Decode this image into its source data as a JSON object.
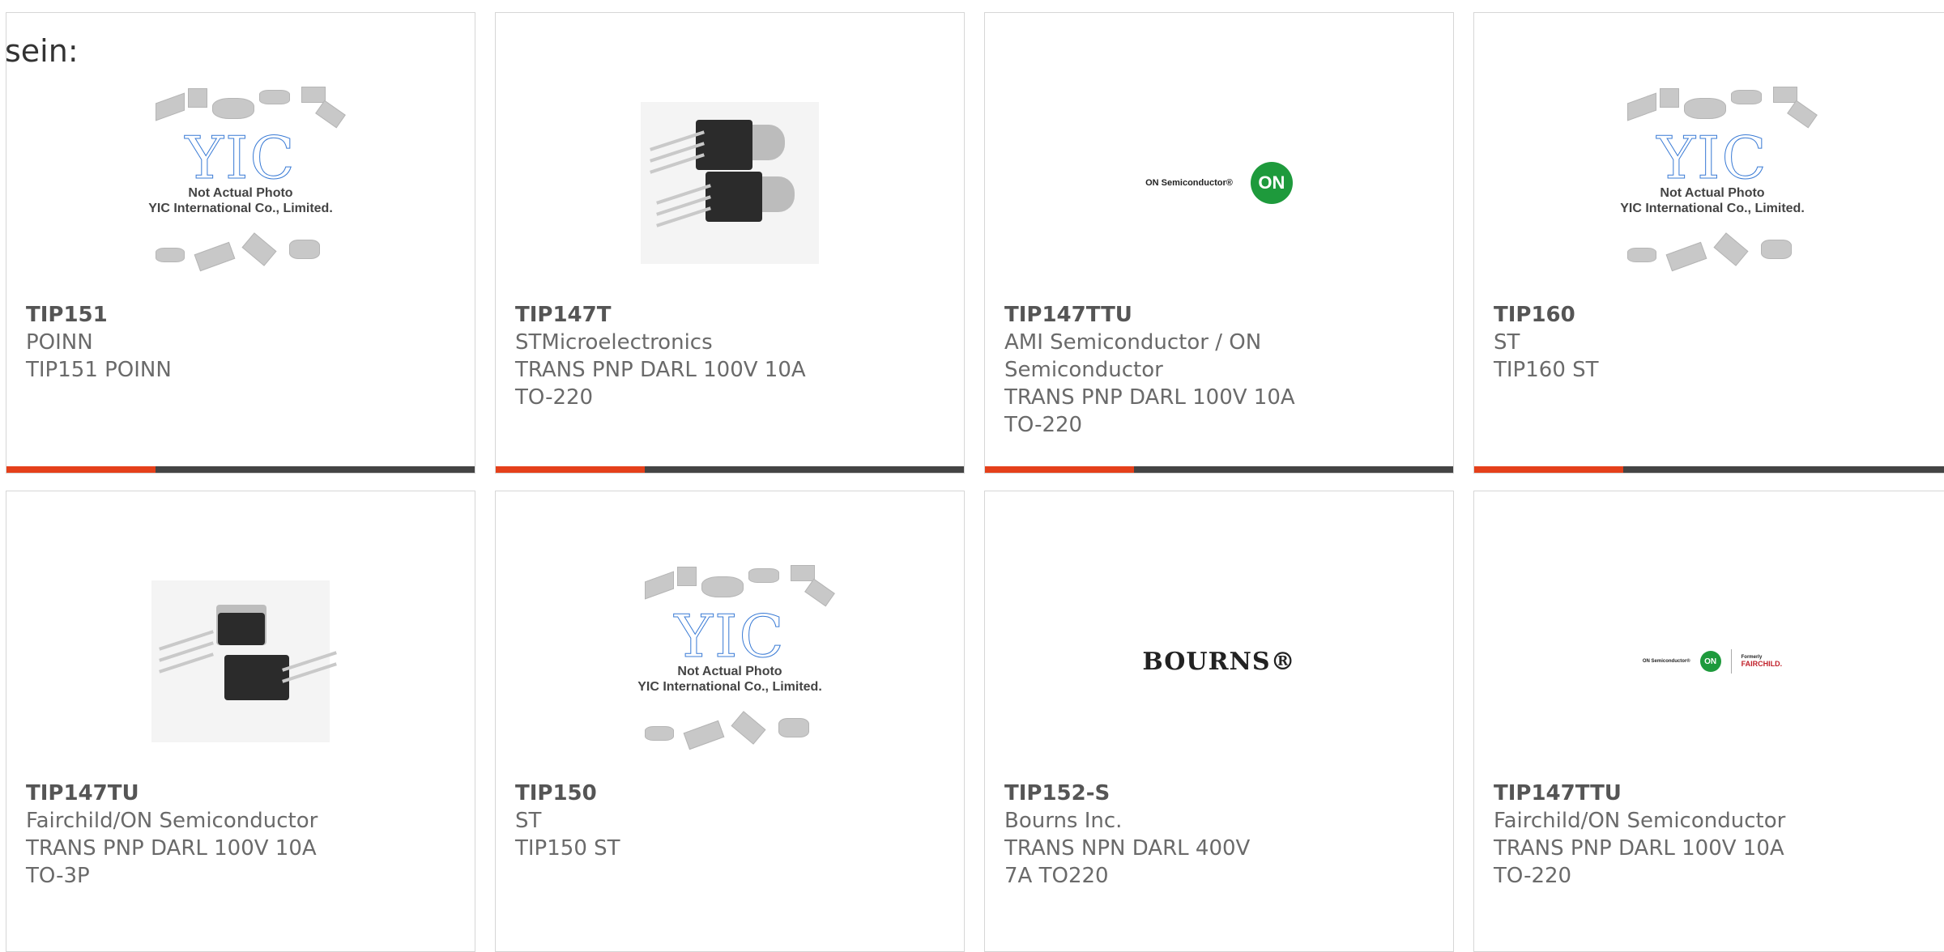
{
  "lead_text": "sein:",
  "products": [
    {
      "part": "TIP151",
      "manufacturer": "POINN",
      "description": "TIP151 POINN",
      "image": "placeholder",
      "placeholder_caption_1": "Not Actual Photo",
      "placeholder_caption_2": "YIC International Co., Limited."
    },
    {
      "part": "TIP147T",
      "manufacturer": "STMicroelectronics",
      "description": "TRANS PNP DARL 100V 10A TO-220",
      "image": "to220-photo"
    },
    {
      "part": "TIP147TTU",
      "manufacturer": "AMI Semiconductor / ON Semiconductor",
      "description": "TRANS PNP DARL 100V 10A TO-220",
      "image": "on-semi-logo",
      "logo_text": "ON Semiconductor®",
      "logo_mark": "ON"
    },
    {
      "part": "TIP160",
      "manufacturer": "ST",
      "description": "TIP160 ST",
      "image": "placeholder",
      "placeholder_caption_1": "Not Actual Photo",
      "placeholder_caption_2": "YIC International Co., Limited."
    },
    {
      "part": "TIP147TU",
      "manufacturer": "Fairchild/ON Semiconductor",
      "description": "TRANS PNP DARL 100V 10A TO-3P",
      "image": "to3p-photo"
    },
    {
      "part": "TIP150",
      "manufacturer": "ST",
      "description": "TIP150 ST",
      "image": "placeholder",
      "placeholder_caption_1": "Not Actual Photo",
      "placeholder_caption_2": "YIC International Co., Limited."
    },
    {
      "part": "TIP152-S",
      "manufacturer": "Bourns Inc.",
      "description": "TRANS NPN DARL 400V 7A TO220",
      "image": "bourns-logo",
      "logo_text": "BOURNS®"
    },
    {
      "part": "TIP147TTU",
      "manufacturer": "Fairchild/ON Semiconductor",
      "description": "TRANS PNP DARL 100V 10A TO-220",
      "image": "on-fairchild-logo",
      "logo_text": "ON Semiconductor®",
      "logo_mark": "ON",
      "logo_text_2": "Formerly",
      "logo_text_3": "FAIRCHILD."
    }
  ],
  "colors": {
    "accent_bar": "#e5401a",
    "bar": "#444444",
    "card_border": "#d6d6d6"
  }
}
